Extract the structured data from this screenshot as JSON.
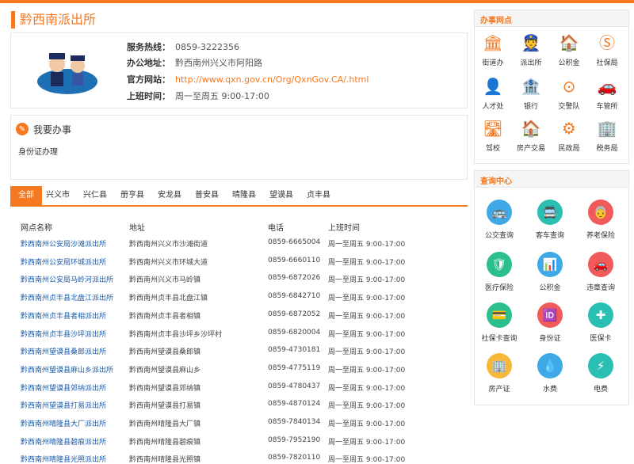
{
  "page": {
    "title": "黔西南派出所"
  },
  "info": {
    "phone_label": "服务热线：",
    "phone": "0859-3222356",
    "address_label": "办公地址：",
    "address": "黔西南州兴义市阿阳路",
    "site_label": "官方网站：",
    "site": "http://www.qxn.gov.cn/Org/QxnGov.CA/.html",
    "hours_label": "上班时间：",
    "hours": "周一至周五 9:00-17:00"
  },
  "work": {
    "title": "我要办事",
    "subtitle": "身份证办理"
  },
  "tabs": [
    "全部",
    "兴义市",
    "兴仁县",
    "册亨县",
    "安龙县",
    "普安县",
    "晴隆县",
    "望谟县",
    "贞丰县"
  ],
  "table": {
    "headers": [
      "网点名称",
      "地址",
      "电话",
      "上班时间"
    ],
    "rows": [
      [
        "黔西南州公安局沙滩派出所",
        "黔西南州兴义市沙滩街道",
        "0859-6665004",
        "周一至周五 9:00-17:00"
      ],
      [
        "黔西南州公安局环城派出所",
        "黔西南州兴义市环城大道",
        "0859-6660110",
        "周一至周五 9:00-17:00"
      ],
      [
        "黔西南州公安局马岭河派出所",
        "黔西南州兴义市马岭镇",
        "0859-6872026",
        "周一至周五 9:00-17:00"
      ],
      [
        "黔西南州贞丰县北盘江派出所",
        "黔西南州贞丰县北盘江镇",
        "0859-6842710",
        "周一至周五 9:00-17:00"
      ],
      [
        "黔西南州贞丰县者相派出所",
        "黔西南州贞丰县者相镇",
        "0859-6872052",
        "周一至周五 9:00-17:00"
      ],
      [
        "黔西南州贞丰县沙坪派出所",
        "黔西南州贞丰县沙坪乡沙坪村",
        "0859-6820004",
        "周一至周五 9:00-17:00"
      ],
      [
        "黔西南州望谟县桑郎派出所",
        "黔西南州望谟县桑郎镇",
        "0859-4730181",
        "周一至周五 9:00-17:00"
      ],
      [
        "黔西南州望谟县麻山乡派出所",
        "黔西南州望谟县麻山乡",
        "0859-4775119",
        "周一至周五 9:00-17:00"
      ],
      [
        "黔西南州望谟县郊纳派出所",
        "黔西南州望谟县郊纳镇",
        "0859-4780437",
        "周一至周五 9:00-17:00"
      ],
      [
        "黔西南州望谟县打易派出所",
        "黔西南州望谟县打易镇",
        "0859-4870124",
        "周一至周五 9:00-17:00"
      ],
      [
        "黔西南州晴隆县大厂派出所",
        "黔西南州晴隆县大厂镇",
        "0859-7840134",
        "周一至周五 9:00-17:00"
      ],
      [
        "黔西南州晴隆县碧痕派出所",
        "黔西南州晴隆县碧痕镇",
        "0859-7952190",
        "周一至周五 9:00-17:00"
      ],
      [
        "黔西南州晴隆县光照派出所",
        "黔西南州晴隆县光照镇",
        "0859-7820110",
        "周一至周五 9:00-17:00"
      ]
    ]
  },
  "services": {
    "title": "办事网点",
    "items": [
      {
        "label": "街道办",
        "icon": "building-icon",
        "glyph": "🏛"
      },
      {
        "label": "派出所",
        "icon": "police-icon",
        "glyph": "👮"
      },
      {
        "label": "公积金",
        "icon": "house-coin-icon",
        "glyph": "🏠"
      },
      {
        "label": "社保局",
        "icon": "social-security-icon",
        "glyph": "Ⓢ"
      },
      {
        "label": "人才处",
        "icon": "person-icon",
        "glyph": "👤"
      },
      {
        "label": "银行",
        "icon": "bank-icon",
        "glyph": "🏦"
      },
      {
        "label": "交警队",
        "icon": "steering-wheel-icon",
        "glyph": "⊙"
      },
      {
        "label": "车管所",
        "icon": "car-icon",
        "glyph": "🚗"
      },
      {
        "label": "驾校",
        "icon": "road-icon",
        "glyph": "🛣"
      },
      {
        "label": "房产交易",
        "icon": "house-icon",
        "glyph": "🏠"
      },
      {
        "label": "民政局",
        "icon": "emblem-icon",
        "glyph": "⚙"
      },
      {
        "label": "税务局",
        "icon": "tax-icon",
        "glyph": "🏢"
      }
    ]
  },
  "queries": {
    "title": "查询中心",
    "items": [
      {
        "label": "公交查询",
        "icon": "bus-icon",
        "color": "#3fa9e8",
        "glyph": "🚌"
      },
      {
        "label": "客车查询",
        "icon": "coach-icon",
        "color": "#2bbfb3",
        "glyph": "🚍"
      },
      {
        "label": "养老保险",
        "icon": "elderly-icon",
        "color": "#f05a5a",
        "glyph": "👵"
      },
      {
        "label": "医疗保险",
        "icon": "shield-icon",
        "color": "#2bbf8f",
        "glyph": "🛡"
      },
      {
        "label": "公积金",
        "icon": "chart-icon",
        "color": "#3fa9e8",
        "glyph": "📊"
      },
      {
        "label": "违章查询",
        "icon": "car-icon",
        "color": "#f05a5a",
        "glyph": "🚗"
      },
      {
        "label": "社保卡查询",
        "icon": "card-icon",
        "color": "#2bbf8f",
        "glyph": "💳"
      },
      {
        "label": "身份证",
        "icon": "id-card-icon",
        "color": "#f05a5a",
        "glyph": "🆔"
      },
      {
        "label": "医保卡",
        "icon": "medical-cross-icon",
        "color": "#2bbfb3",
        "glyph": "✚"
      },
      {
        "label": "房产证",
        "icon": "building-icon",
        "color": "#f5b83a",
        "glyph": "🏢"
      },
      {
        "label": "水费",
        "icon": "water-drop-icon",
        "color": "#3fa9e8",
        "glyph": "💧"
      },
      {
        "label": "电费",
        "icon": "bill-icon",
        "color": "#2bbfb3",
        "glyph": "⚡"
      }
    ]
  }
}
